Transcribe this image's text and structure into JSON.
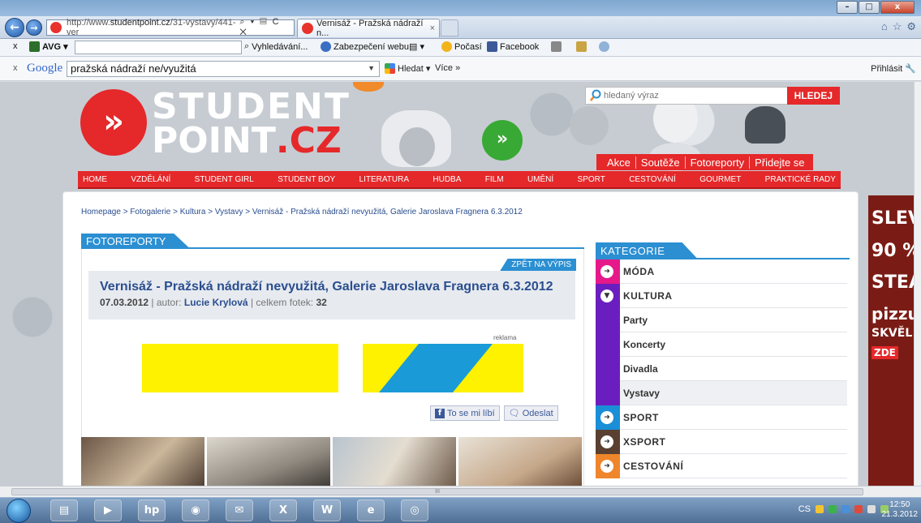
{
  "window": {
    "minimize": "–",
    "maximize": "□",
    "close": "x"
  },
  "browser": {
    "back": "←",
    "forward": "→",
    "address_prefix": "http://www.",
    "address_domain": "studentpoint.cz",
    "address_rest": "/31-vystavy/441-ver",
    "address_tools": "⌕ ▾ ▤ C ✕",
    "tab_title": "Vernisáž - Pražská nádraží n...",
    "tab_close": "×",
    "right_icons": [
      "⌂",
      "☆",
      "⚙"
    ]
  },
  "favbar": {
    "close": "x",
    "avg": "AVG ▾",
    "search": "Vyhledávání...",
    "security": "Zabezpečení webu",
    "menu": "▤ ▾",
    "weather": "Počasí",
    "facebook": "Facebook"
  },
  "googlebar": {
    "close": "x",
    "logo": "Google",
    "query": "pražská nádraží ne/využitá",
    "search_btn": "Hledat ▾",
    "more": "Více »",
    "login": "Přihlásit"
  },
  "site": {
    "logo_line1": "STUDENT",
    "logo_line2": "POINT",
    "logo_tld": ".CZ",
    "logo_arrows": "»",
    "search_placeholder": "hledaný výraz",
    "search_button": "HLEDEJ",
    "quicklinks": [
      "Akce",
      "Soutěže",
      "Fotoreporty",
      "Přidejte se"
    ],
    "nav": [
      "HOME",
      "VZDĚLÁNÍ",
      "STUDENT GIRL",
      "STUDENT BOY",
      "LITERATURA",
      "HUDBA",
      "FILM",
      "UMĚNÍ",
      "SPORT",
      "CESTOVÁNÍ",
      "GOURMET",
      "PRAKTICKÉ RADY"
    ],
    "breadcrumb": "Homepage > Fotogalerie > Kultura > Vystavy > Vernisáž - Pražská nádraží nevyužitá, Galerie Jaroslava Fragnera 6.3.2012",
    "section_tab": "FOTOREPORTY",
    "back_link": "ZPĚT NA VÝPIS",
    "article_title": "Vernisáž - Pražská nádraží nevyužitá, Galerie Jaroslava Fragnera 6.3.2012",
    "article_date": "07.03.2012",
    "meta_author_label": "| autor:",
    "article_author": "Lucie Krylová",
    "meta_count_label": "| celkem fotek:",
    "photo_count": "32",
    "ad_label": "reklama",
    "like_button": "To se mi líbí",
    "send_button": "Odeslat",
    "sidebar_tab": "KATEGORIE",
    "categories": [
      {
        "label": "MÓDA",
        "color": "#e6198a",
        "type": "main"
      },
      {
        "label": "KULTURA",
        "color": "#6b1ebf",
        "type": "main"
      },
      {
        "label": "Party",
        "color": "#6b1ebf",
        "type": "sub"
      },
      {
        "label": "Koncerty",
        "color": "#6b1ebf",
        "type": "sub"
      },
      {
        "label": "Divadla",
        "color": "#6b1ebf",
        "type": "sub"
      },
      {
        "label": "Vystavy",
        "color": "#6b1ebf",
        "type": "sub"
      },
      {
        "label": "SPORT",
        "color": "#1a8fd7",
        "type": "main"
      },
      {
        "label": "XSPORT",
        "color": "#5a4030",
        "type": "main"
      },
      {
        "label": "CESTOVÁNÍ",
        "color": "#f0862b",
        "type": "main"
      }
    ],
    "right_ad": [
      "SLEV",
      "90 %",
      "STEA",
      "pizzu",
      "SKVĚL"
    ],
    "right_ad_cta": "ZDE"
  },
  "taskbar": {
    "lang": "CS",
    "time": "12:50",
    "date": "21.3.2012",
    "scroll_marker": "III"
  }
}
